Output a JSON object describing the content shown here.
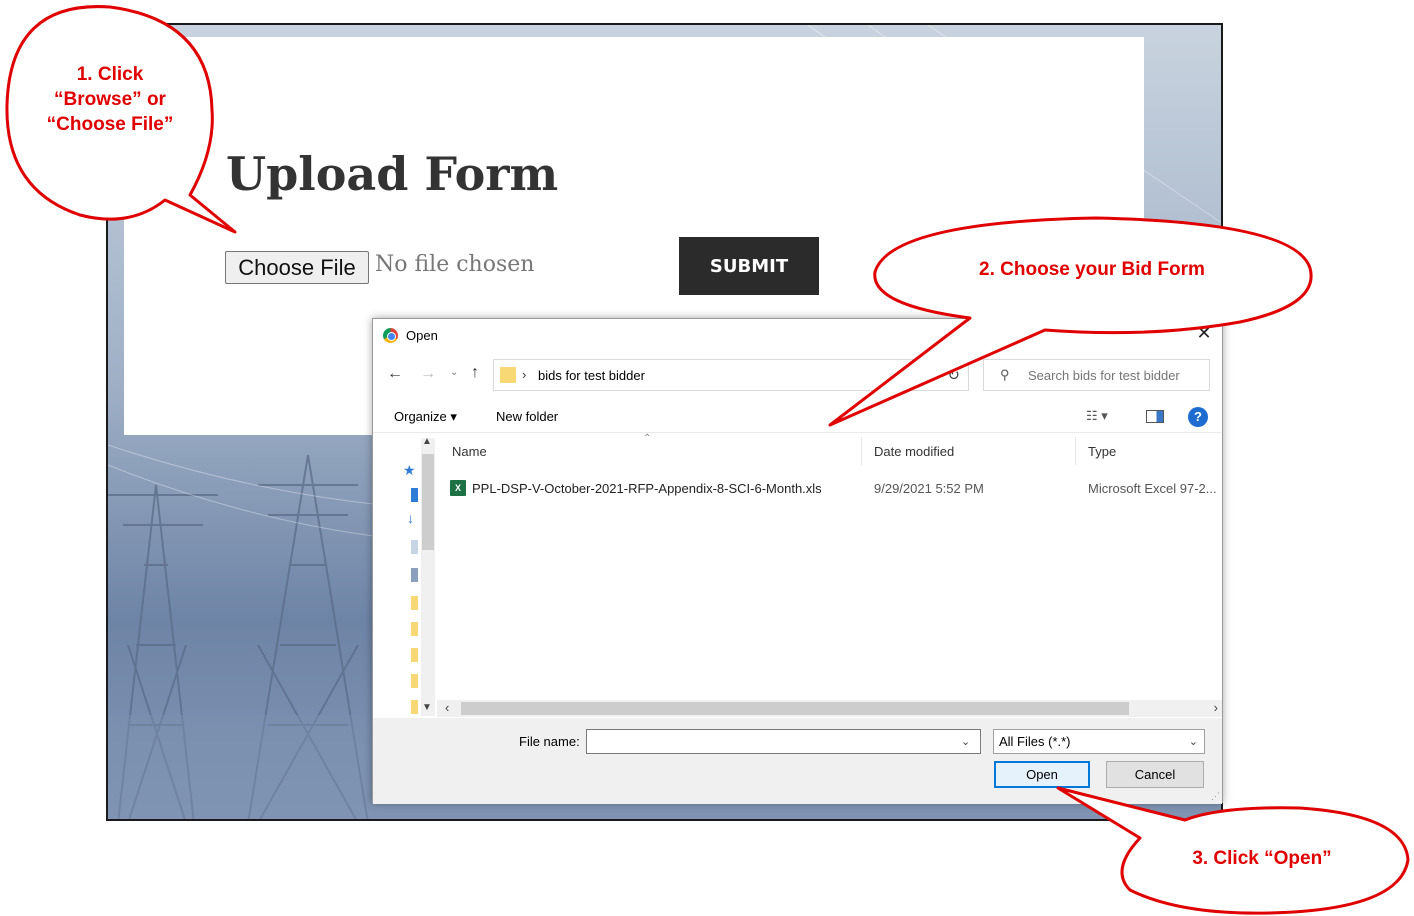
{
  "upload_page": {
    "title": "Upload Form",
    "choose_file_label": "Choose File",
    "no_file_text": "No file chosen",
    "submit_label": "SUBMIT"
  },
  "dialog": {
    "title": "Open",
    "close_glyph": "✕",
    "address": {
      "path": "bids for test bidder",
      "separator": "›"
    },
    "search_placeholder": "Search bids for test bidder",
    "toolbar": {
      "organize_label": "Organize ▾",
      "new_folder_label": "New folder",
      "view_label": "☷ ▾",
      "help_glyph": "?"
    },
    "columns": {
      "name": "Name",
      "date_modified": "Date modified",
      "type": "Type"
    },
    "files": [
      {
        "name": "PPL-DSP-V-October-2021-RFP-Appendix-8-SCI-6-Month.xls",
        "date_modified": "9/29/2021 5:52 PM",
        "type": "Microsoft Excel 97-2...",
        "icon": "excel-file-icon"
      }
    ],
    "footer": {
      "file_name_label": "File name:",
      "file_name_value": "",
      "file_type_value": "All Files (*.*)",
      "open_label": "Open",
      "cancel_label": "Cancel"
    }
  },
  "callouts": [
    {
      "text": "1. Click “Browse” or “Choose File”"
    },
    {
      "text": "2. Choose your Bid Form"
    },
    {
      "text": "3. Click “Open”"
    }
  ],
  "colors": {
    "callout_red": "#e00000",
    "submit_bg": "#2b2b2b",
    "open_button_border": "#0078d7"
  }
}
